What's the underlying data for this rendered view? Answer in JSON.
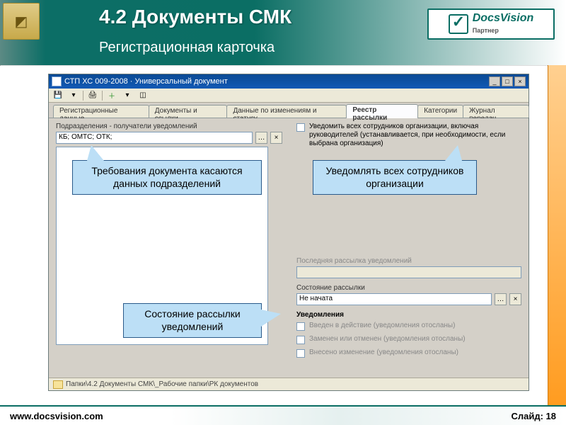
{
  "slide": {
    "title": "4.2 Документы СМК",
    "subtitle": "Регистрационная карточка",
    "footer_url": "www.docsvision.com",
    "footer_slide": "Слайд: 18",
    "brand_name": "DocsVision",
    "brand_sub": "Партнер"
  },
  "app": {
    "title": "СТП ХС 009-2008 · Универсальный документ",
    "tabs": [
      "Регистрационные данные",
      "Документы и ссылки",
      "Данные по изменениям и статусу",
      "Реестр рассылки",
      "Категории",
      "Журнал передач"
    ],
    "active_tab": 3,
    "group_label": "Подразделения - получатели уведомлений",
    "recipients_value": "КБ; ОМТС; ОТК;",
    "notify_all": "Уведомить всех сотрудников организации, включая руководителей (устанавливается, при необходимости, если выбрана организация)",
    "last_send_label": "Последняя рассылка уведомлений",
    "status_label": "Состояние рассылки",
    "status_value": "Не начата",
    "notices_header": "Уведомления",
    "notice1": "Введен в действие (уведомления отосланы)",
    "notice2": "Заменен или отменен (уведомления отосланы)",
    "notice3": "Внесено изменение (уведомления отосланы)",
    "path": "Папки\\4.2    Документы СМК\\_Рабочие папки\\РК документов"
  },
  "callouts": {
    "c1": "Требования документа касаются данных подразделений",
    "c2": "Уведомлять всех сотрудников организации",
    "c3": "Состояние рассылки уведомлений"
  }
}
